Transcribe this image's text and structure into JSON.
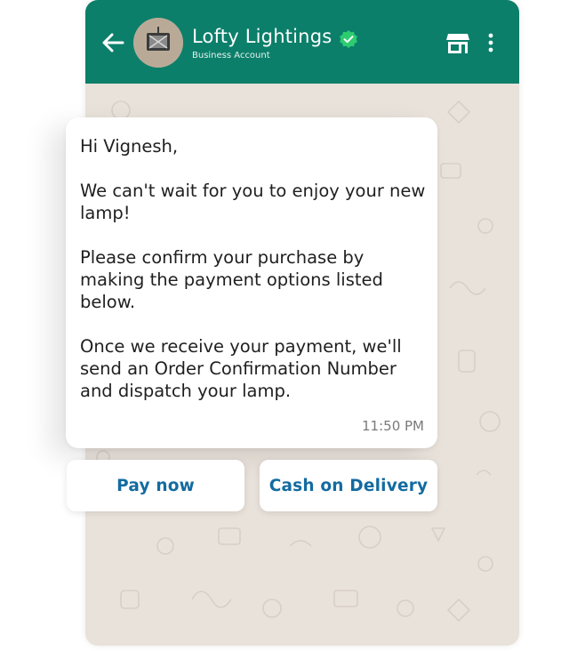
{
  "header": {
    "business_name": "Lofty Lightings",
    "account_type": "Business Account",
    "back_icon": "arrow-left-icon",
    "verified_icon": "verified-badge-icon",
    "store_icon": "storefront-icon",
    "menu_icon": "more-vertical-icon",
    "bg_color": "#0b7f6a"
  },
  "message": {
    "text": "Hi Vignesh,\n\nWe can't wait for you to enjoy your new lamp!\n\nPlease confirm your purchase by making the payment options listed below.\n\nOnce we receive your payment, we'll send an Order Confirmation Number and dispatch your lamp.",
    "time": "11:50 PM"
  },
  "buttons": {
    "pay_now": "Pay now",
    "cash_on_delivery": "Cash on Delivery",
    "color": "#136ba0"
  }
}
